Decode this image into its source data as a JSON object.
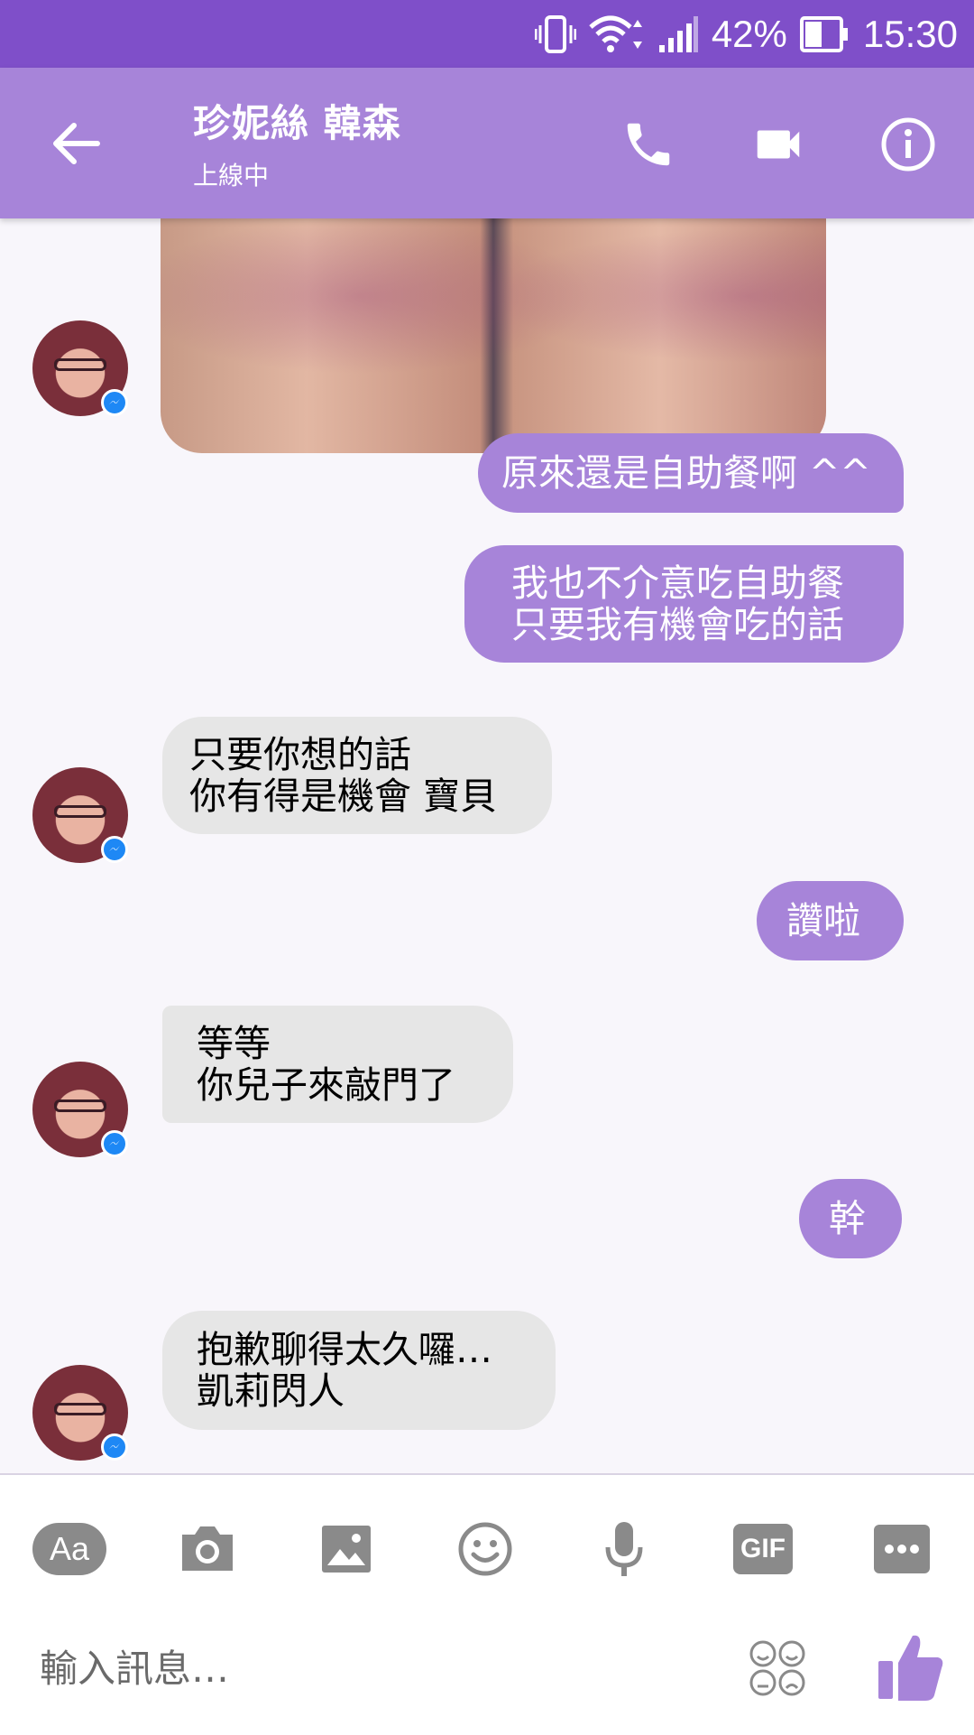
{
  "status_bar": {
    "battery": "42%",
    "time": "15:30",
    "icons": [
      "vibrate-icon",
      "wifi-icon",
      "signal-icon",
      "battery-icon"
    ]
  },
  "header": {
    "contact_name": "珍妮絲 韓森",
    "contact_status": "上線中",
    "buttons": [
      "back-arrow-icon",
      "phone-icon",
      "video-camera-icon",
      "info-icon"
    ]
  },
  "messages": [
    {
      "from": "contact",
      "type": "image"
    },
    {
      "from": "me",
      "text": "原來還是自助餐啊 ^^"
    },
    {
      "from": "me",
      "text": "我也不介意吃自助餐\n只要我有機會吃的話"
    },
    {
      "from": "contact",
      "text": "只要你想的話\n你有得是機會 寶貝"
    },
    {
      "from": "me",
      "text": "讚啦"
    },
    {
      "from": "contact",
      "text": "等等\n你兒子來敲門了"
    },
    {
      "from": "me",
      "text": "幹"
    },
    {
      "from": "contact",
      "text": "抱歉聊得太久囉…\n凱莉閃人"
    }
  ],
  "composer": {
    "toolbar": [
      {
        "icon": "text-size-icon",
        "label": "Aa"
      },
      {
        "icon": "camera-icon"
      },
      {
        "icon": "gallery-icon"
      },
      {
        "icon": "emoji-icon"
      },
      {
        "icon": "microphone-icon"
      },
      {
        "icon": "gif-icon",
        "label": "GIF"
      },
      {
        "icon": "more-icon"
      }
    ],
    "placeholder": "輸入訊息…",
    "emoji_button_icon": "emoji-grid-icon",
    "send_icon": "thumbs-up-icon"
  },
  "colors": {
    "status_bar": "#7f4fc9",
    "header": "#a784d9",
    "outgoing_bubble": "#a784d9",
    "incoming_bubble": "#e6e6e6",
    "toolbar_icon": "#8a8a8a"
  }
}
